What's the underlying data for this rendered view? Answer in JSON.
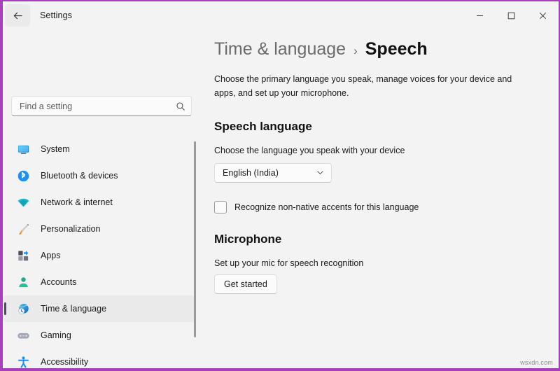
{
  "window": {
    "app_title": "Settings",
    "back_icon": "back-arrow-icon",
    "controls": {
      "minimize": "—",
      "maximize": "☐",
      "close": "✕"
    },
    "border_color": "#a83fbb",
    "background": "#f3f3f3"
  },
  "search": {
    "placeholder": "Find a setting",
    "value": "",
    "icon": "search-icon"
  },
  "sidebar": {
    "items": [
      {
        "label": "System",
        "icon": "monitor-icon",
        "selected": false
      },
      {
        "label": "Bluetooth & devices",
        "icon": "bluetooth-icon",
        "selected": false
      },
      {
        "label": "Network & internet",
        "icon": "wifi-icon",
        "selected": false
      },
      {
        "label": "Personalization",
        "icon": "paintbrush-icon",
        "selected": false
      },
      {
        "label": "Apps",
        "icon": "apps-icon",
        "selected": false
      },
      {
        "label": "Accounts",
        "icon": "person-icon",
        "selected": false
      },
      {
        "label": "Time & language",
        "icon": "globe-clock-icon",
        "selected": true
      },
      {
        "label": "Gaming",
        "icon": "gamepad-icon",
        "selected": false
      },
      {
        "label": "Accessibility",
        "icon": "accessibility-person-icon",
        "selected": false
      }
    ]
  },
  "main": {
    "breadcrumb": {
      "parent": "Time & language",
      "separator": "›",
      "current": "Speech"
    },
    "description": "Choose the primary language you speak, manage voices for your device and apps, and set up your microphone.",
    "sections": [
      {
        "title": "Speech language",
        "subtitle": "Choose the language you speak with your device",
        "dropdown": {
          "value": "English (India)",
          "chevron": "chevron-down-icon"
        },
        "checkbox": {
          "label": "Recognize non-native accents for this language",
          "checked": false
        }
      },
      {
        "title": "Microphone",
        "subtitle": "Set up your mic for speech recognition",
        "button": "Get started"
      }
    ]
  },
  "watermark": "wsxdn.com"
}
